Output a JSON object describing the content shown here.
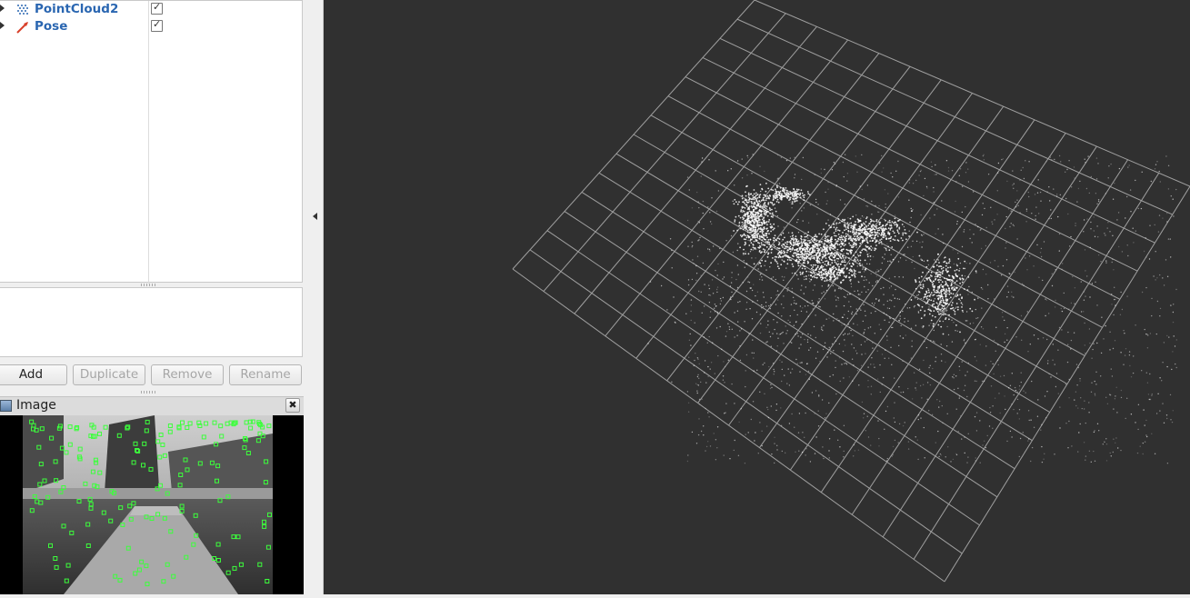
{
  "displays": {
    "items": [
      {
        "label": "PointCloud2",
        "checked": true,
        "icon": "pointcloud-icon"
      },
      {
        "label": "Pose",
        "checked": true,
        "icon": "pose-arrow-icon"
      }
    ]
  },
  "buttons": {
    "add": "Add",
    "duplicate": "Duplicate",
    "remove": "Remove",
    "rename": "Rename"
  },
  "image_panel": {
    "title": "Image",
    "close_label": "✖"
  },
  "colors": {
    "viewport_bg": "#303030",
    "grid": "#a0a0a0",
    "point": "#ffffff",
    "feature": "#3cff3c",
    "label_blue": "#2a66b1"
  }
}
